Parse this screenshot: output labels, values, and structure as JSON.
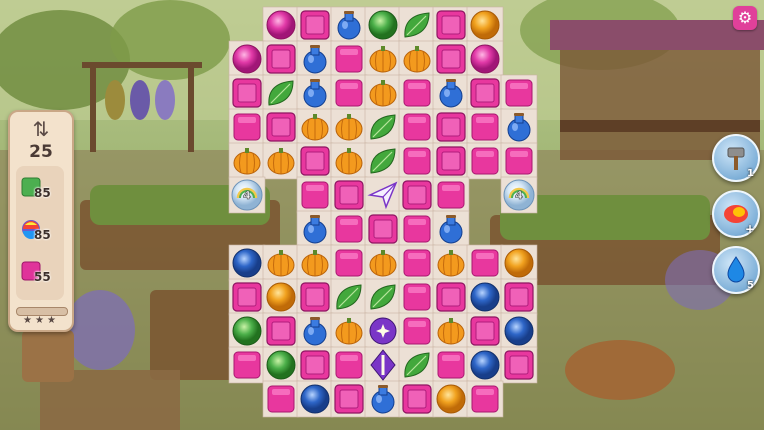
{
  "hud": {
    "moves": "25",
    "moves_icon": "swap-arrows-icon",
    "goals": [
      {
        "icon": "green-tile-icon",
        "color": "#4caf50",
        "count": "85"
      },
      {
        "icon": "rainbow-ball-icon",
        "color": "#6a5acd",
        "count": "85"
      },
      {
        "icon": "magenta-tile-icon",
        "color": "#e0339a",
        "count": "55"
      }
    ],
    "progress": 0,
    "stars_total": 3
  },
  "boosters": [
    {
      "name": "hammer-booster",
      "icon": "hammer-icon",
      "count": "1"
    },
    {
      "name": "fire-booster",
      "icon": "fireball-icon",
      "count": "+"
    },
    {
      "name": "water-booster",
      "icon": "water-drop-icon",
      "count": "5"
    }
  ],
  "settings_icon": "gear-icon",
  "colors": {
    "pink_tile": "#e8379e",
    "pumpkin": "#f39a1e",
    "leaf": "#43a83c",
    "potion": "#2f6fd6",
    "magenta_gem": "#e23aa8",
    "orange_gem": "#f1a21f",
    "green_gem": "#4cb04a",
    "blue_gem": "#2e66c8",
    "purple_special": "#7a35c7",
    "board": "#ece0d5"
  },
  "board": {
    "rows": 12,
    "cols": 9,
    "legend": {
      "M": "pink-crate-tile",
      "m": "pink-tile",
      "U": "pumpkin",
      "L": "leaf",
      "B": "blue-potion",
      "P": "magenta-gem",
      "O": "orange-gem",
      "G": "green-gem",
      "N": "blue-gem",
      "A": "paper-plane",
      "S": "star-bomb",
      "V": "purple-rocket",
      "R": "rainbow-bubble",
      "-": "empty",
      ".": "no-cell"
    },
    "grid": [
      ".PMBGLMO.",
      "PMBmUUMP",
      "MLBmUmBMm",
      "mMUULmMmB",
      "UUMULmMmm",
      "R.mMAMm.R",
      "..BmMmB..",
      "NUUmUmUmO",
      "MOMLLmMNM",
      "GMBUSmUMN",
      "mGMmVLmNM",
      ".mNMBMOm."
    ],
    "bubbles": [
      {
        "row": 5,
        "col": 0,
        "count": "4"
      },
      {
        "row": 5,
        "col": 8,
        "count": "4"
      }
    ]
  }
}
